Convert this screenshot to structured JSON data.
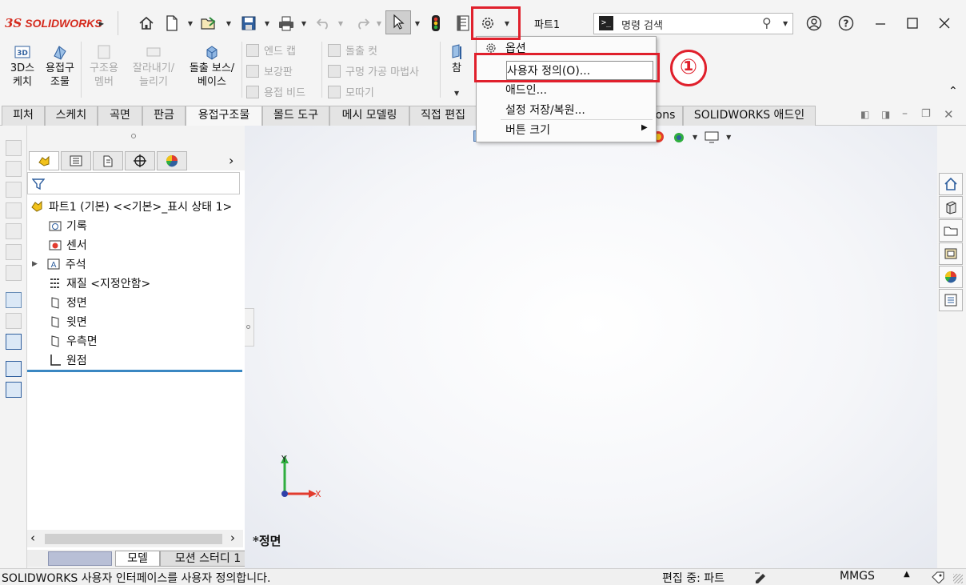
{
  "titlebar": {
    "logo_ds": "3S",
    "logo_text": "SOLIDWORKS",
    "document_title": "파트1",
    "search_placeholder": "명령 검색",
    "search_cmd_icon": ">_"
  },
  "command_manager": {
    "sketch3d": [
      "3D스",
      "케치"
    ],
    "weldment": [
      "용접구",
      "조물"
    ],
    "structural_member": [
      "구조용",
      "멤버"
    ],
    "trim_extend": [
      "잘라내기/",
      "늘리기"
    ],
    "extruded_boss": [
      "돌출 보스/",
      "베이스"
    ],
    "end_cap": "엔드 캡",
    "gusset": "보강판",
    "weld_bead": "용접 비드",
    "extruded_cut": "돌출 컷",
    "hole_wizard": "구멍 가공 마법사",
    "chamfer": "모따기",
    "reference": "참"
  },
  "tabs": [
    "피처",
    "스케치",
    "곡면",
    "판금",
    "용접구조물",
    "몰드 도구",
    "메시 모델링",
    "직접 편집",
    "ons",
    "SOLIDWORKS 애드인"
  ],
  "tree": {
    "root": "파트1 (기본) <<기본>_표시 상태 1>",
    "items": [
      "기록",
      "센서",
      "주석",
      "재질 <지정안함>",
      "정면",
      "윗면",
      "우측면",
      "원점"
    ]
  },
  "bottom_tabs": [
    "모델",
    "모션 스터디 1"
  ],
  "viewport": {
    "view_label": "*정면",
    "axis_x": "X",
    "axis_y": "Y"
  },
  "menu": {
    "items": [
      "옵션",
      "사용자 정의(O)...",
      "애드인...",
      "설정 저장/복원...",
      "버튼 크기"
    ],
    "annotation_badge": "①"
  },
  "status": {
    "message": "SOLIDWORKS 사용자 인터페이스를 사용자 정의합니다.",
    "editing": "편집 중: 파트",
    "units": "MMGS"
  },
  "colors": {
    "accent": "#d52b1e",
    "highlight": "#e0202c",
    "rollback": "#3a87c2"
  }
}
